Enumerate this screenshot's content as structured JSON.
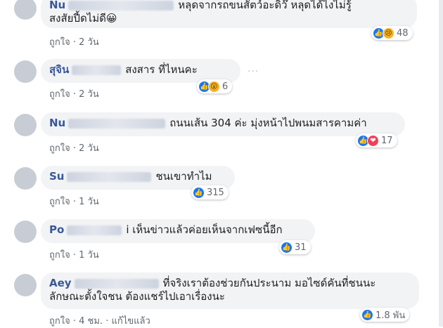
{
  "comments": [
    {
      "author": "Nu",
      "text": "หลุดจากรถขนสัตว์อะดิว๊ หลุดได้ไงไม่รู้ สงสัยปี้ดไม่ดี😀",
      "line1": "หลุดจากรถขนสัตว์อะดิว๊ หลุดได้ไงไม่รู้",
      "line2": "สงสัยปี้ดไม่ดี😀",
      "like_label": "ถูกใจ",
      "time": "2 วัน",
      "reactions": [
        "like-icon",
        "sad-icon"
      ],
      "count": "48"
    },
    {
      "author": "สุจิน",
      "text": "สงสาร ที่ไหนคะ",
      "like_label": "ถูกใจ",
      "time": "2 วัน",
      "reactions": [
        "like-icon",
        "wow-icon"
      ],
      "count": "6"
    },
    {
      "author": "Nu",
      "text": "ถนนเส้น 304 ค่ะ มุ่งหน้าไปพนมสารคามค่า",
      "like_label": "ถูกใจ",
      "time": "2 วัน",
      "reactions": [
        "like-icon",
        "love-icon"
      ],
      "count": "17"
    },
    {
      "author": "Su",
      "text": "ชนเขาทำไม",
      "like_label": "ถูกใจ",
      "time": "1 วัน",
      "reactions": [
        "like-icon"
      ],
      "count": "315"
    },
    {
      "author": "Po",
      "text": "i เห็นข่าวแล้วค่อยเห็นจากเฟซนี้อีก",
      "like_label": "ถูกใจ",
      "time": "1 วัน",
      "reactions": [
        "like-icon"
      ],
      "count": "31"
    },
    {
      "author": "Aey",
      "line1": "ที่จริงเราต้องช่วยกันประนาม มอไซด์คันที่ชนนะ",
      "line2": "ลักษณะตั้งใจชน ต้องแชร์ไปเอาเรื่องนะ",
      "like_label": "ถูกใจ",
      "time": "4 ชม.",
      "edited": "แก้ไขแล้ว",
      "reactions": [
        "like-icon"
      ],
      "count": "1.8 พัน"
    }
  ],
  "separator": " · ",
  "more_dots": "···",
  "colors": {
    "link": "#385898",
    "bubble": "#f2f3f5",
    "like": "#1877f2",
    "love": "#f33e58",
    "sad": "#f7b125"
  }
}
